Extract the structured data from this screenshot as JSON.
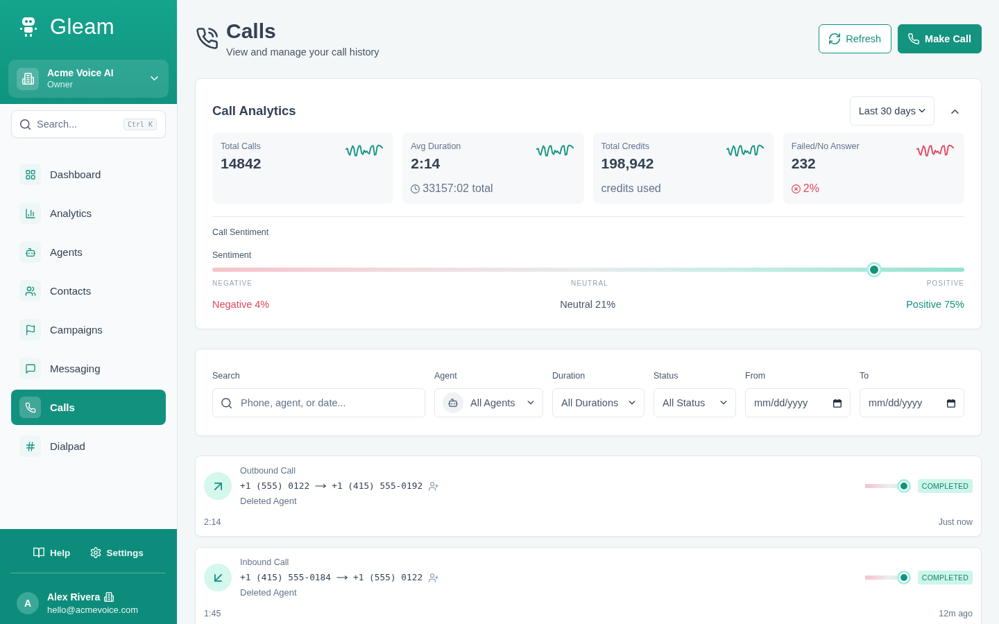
{
  "sidebar": {
    "brand": "Gleam",
    "workspace": {
      "name": "Acme Voice AI",
      "role": "Owner"
    },
    "search": {
      "placeholder": "Search...",
      "shortcut": "Ctrl K"
    },
    "items": [
      {
        "label": "Dashboard",
        "selected": false
      },
      {
        "label": "Analytics",
        "selected": false
      },
      {
        "label": "Agents",
        "selected": false
      },
      {
        "label": "Contacts",
        "selected": false
      },
      {
        "label": "Campaigns",
        "selected": false
      },
      {
        "label": "Messaging",
        "selected": false
      },
      {
        "label": "Calls",
        "selected": true
      },
      {
        "label": "Dialpad",
        "selected": false
      }
    ],
    "footer_links": [
      "Help",
      "Settings"
    ],
    "user": {
      "initial": "A",
      "name": "Alex Rivera",
      "email": "hello@acmevoice.com"
    }
  },
  "header": {
    "title": "Calls",
    "subtitle": "View and manage your call history",
    "buttons": [
      {
        "label": "Refresh",
        "kind": "outline"
      },
      {
        "label": "Make Call",
        "kind": "primary"
      }
    ]
  },
  "analytics": {
    "title": "Call Analytics",
    "range": "Last 30 days",
    "expanded": true,
    "stats": [
      {
        "label": "Total Calls",
        "value": "14842",
        "kind": "plain"
      },
      {
        "label": "Avg Duration",
        "value": "2:14",
        "note": "33157:02 total",
        "kind": "time"
      },
      {
        "label": "Total Credits",
        "value": "198,942",
        "note": "credits used",
        "kind": "plain"
      },
      {
        "label": "Failed/No Answer",
        "value": "232",
        "note": "2%",
        "kind": "failure"
      }
    ],
    "sentiment": {
      "title": "Call Sentiment",
      "label": "Sentiment",
      "level": 0.88,
      "scale": [
        "NEGATIVE",
        "NEUTRAL",
        "POSITIVE"
      ],
      "breakdown": [
        {
          "label": "Negative 4%",
          "kind": "negative"
        },
        {
          "label": "Neutral 21%",
          "kind": "neutral"
        },
        {
          "label": "Positive 75%",
          "kind": "positive"
        }
      ]
    }
  },
  "filters": [
    {
      "label": "Search",
      "kind": "search",
      "placeholder": "Phone, agent, or date..."
    },
    {
      "label": "Agent",
      "kind": "agent",
      "value": "All Agents"
    },
    {
      "label": "Duration",
      "kind": "select",
      "value": "All Durations"
    },
    {
      "label": "Status",
      "kind": "select",
      "value": "All Status"
    },
    {
      "label": "From",
      "kind": "date",
      "placeholder": "mm/dd/yyyy"
    },
    {
      "label": "To",
      "kind": "date",
      "placeholder": "mm/dd/yyyy"
    }
  ],
  "calls": [
    {
      "kind": "outbound",
      "type": "Outbound Call",
      "from": "+1 (555) 0122",
      "to": "+1 (415) 555-0192",
      "agent": "Deleted Agent",
      "duration": "2:14",
      "level": 0.875,
      "status": "COMPLETED",
      "time": "Just now"
    },
    {
      "kind": "inbound",
      "type": "Inbound Call",
      "from": "+1 (415) 555-0184",
      "to": "+1 (555) 0122",
      "agent": "Deleted Agent",
      "duration": "1:45",
      "level": 0.875,
      "status": "COMPLETED",
      "time": "12m ago"
    }
  ]
}
